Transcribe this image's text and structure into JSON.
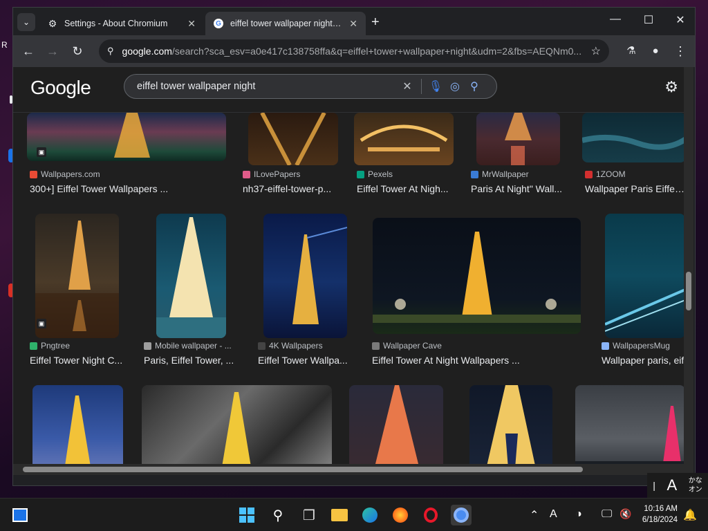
{
  "window": {
    "tabs": [
      {
        "title": "Settings - About Chromium",
        "icon": "gear-icon"
      },
      {
        "title": "eiffel tower wallpaper night - Google Search",
        "icon": "google-icon"
      }
    ],
    "url_host": "google.com",
    "url_rest": "/search?sca_esv=a0e417c138758ffa&q=eiffel+tower+wallpaper+night&udm=2&fbs=AEQNm0..."
  },
  "google": {
    "logo": "Google",
    "query": "eiffel tower wallpaper night"
  },
  "results": [
    {
      "source": "Wallpapers.com",
      "caption": "300+] Eiffel Tower Wallpapers ...",
      "fav": "#e94b35"
    },
    {
      "source": "ILovePapers",
      "caption": "nh37-eiffel-tower-p...",
      "fav": "#e05c8a"
    },
    {
      "source": "Pexels",
      "caption": "Eiffel Tower At Nigh...",
      "fav": "#05a081"
    },
    {
      "source": "MrWallpaper",
      "caption": "Paris At Night\" Wall...",
      "fav": "#3a7bd5"
    },
    {
      "source": "1ZOOM",
      "caption": "Wallpaper Paris Eiffel T",
      "fav": "#d32f2f"
    },
    {
      "source": "Pngtree",
      "caption": "Eiffel Tower Night C...",
      "fav": "#2fb36b"
    },
    {
      "source": "Mobile wallpaper - ...",
      "caption": "Paris, Eiffel Tower, ...",
      "fav": "#9e9e9e"
    },
    {
      "source": "4K Wallpapers",
      "caption": "Eiffel Tower Wallpa...",
      "fav": "#444444"
    },
    {
      "source": "Wallpaper Cave",
      "caption": "Eiffel Tower At Night Wallpapers ...",
      "fav": "#7a7a7a"
    },
    {
      "source": "WallpapersMug",
      "caption": "Wallpaper paris, eif",
      "fav": "#8ab4f8"
    }
  ],
  "ime": {
    "mode": "A",
    "kana": "かな",
    "on": "オン"
  },
  "clock": {
    "time": "10:16 AM",
    "date": "6/18/2024"
  }
}
